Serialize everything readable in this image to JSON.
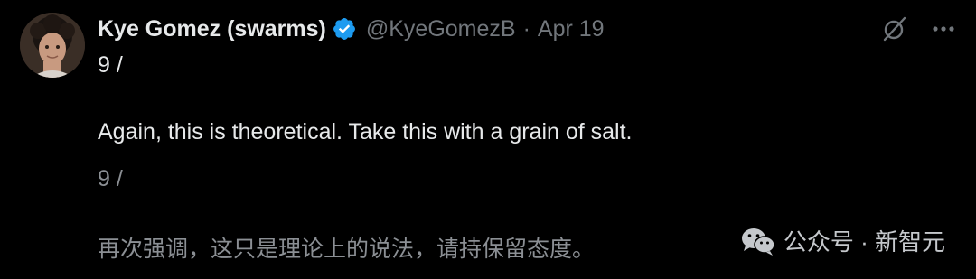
{
  "author": {
    "display_name": "Kye Gomez (swarms)",
    "handle": "@KyeGomezB",
    "separator": "·",
    "date": "Apr 19"
  },
  "icons": {
    "verified": "verified-badge-icon",
    "grok": "grok-icon",
    "more": "more-options-icon",
    "watermark": "wechat-icon"
  },
  "colors": {
    "background": "#000000",
    "text": "#e7e9ea",
    "muted": "#71767b",
    "verified": "#1d9bf0"
  },
  "tweet": {
    "line1": "9 /",
    "line2": "Again, this is theoretical. Take this with a grain of salt.",
    "line3": "9 /",
    "line4": "再次强调，这只是理论上的说法，请持保留态度。"
  },
  "watermark": {
    "label": "公众号 · 新智元"
  }
}
